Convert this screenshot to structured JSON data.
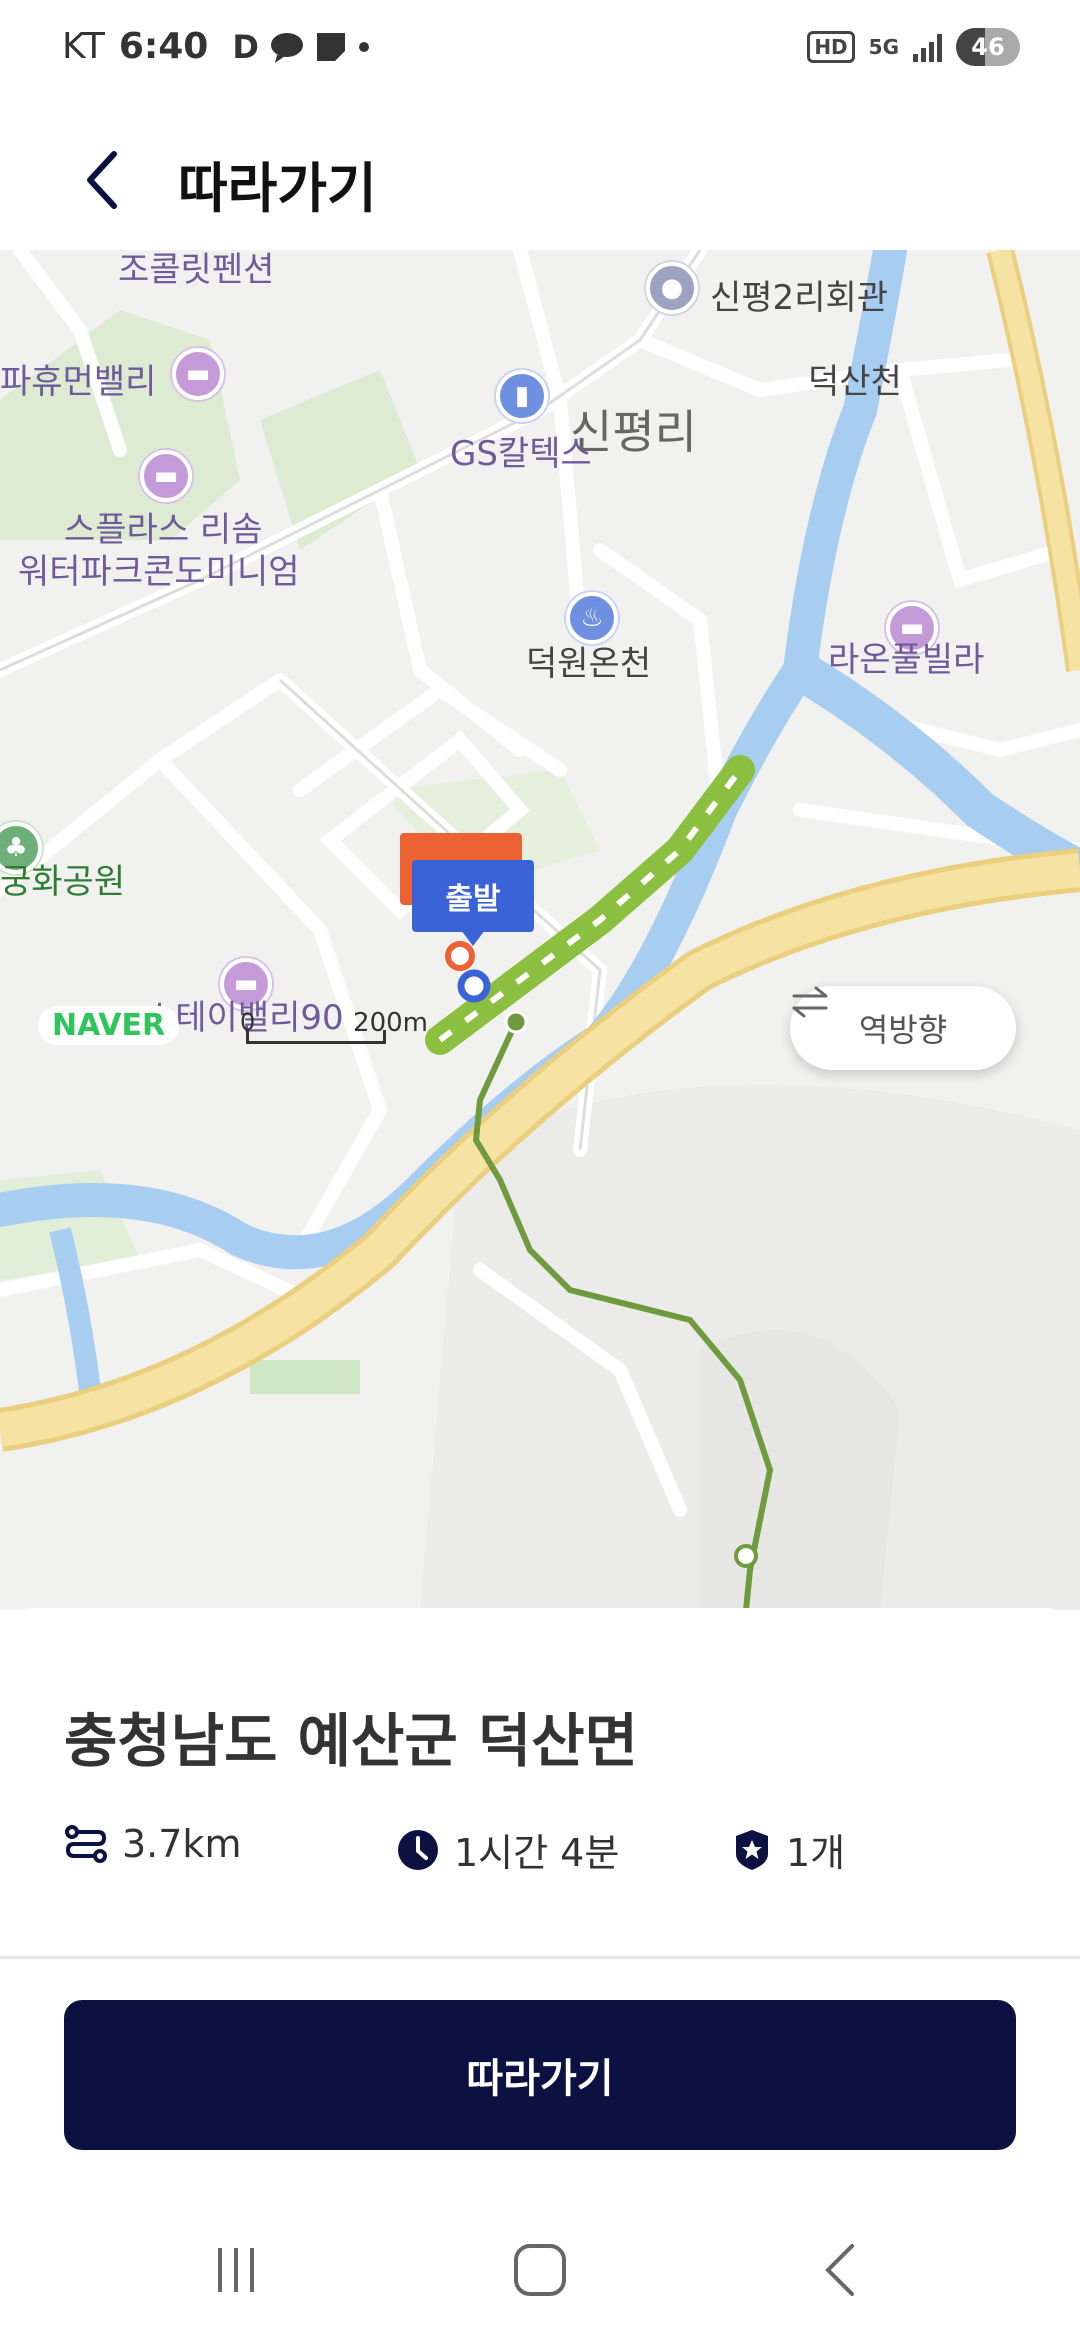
{
  "status_bar": {
    "carrier": "KT",
    "time": "6:40",
    "glyph_d": "D",
    "hd_badge": "HD",
    "network": "5G",
    "battery_percent": "46"
  },
  "header": {
    "title": "따라가기"
  },
  "map": {
    "labels": {
      "chocolate_pension": "조콜릿펜션",
      "sinpyeong_hall": "신평2리회관",
      "human_valley": "파휴먼밸리",
      "gs_caltex": "GS칼텍스",
      "sinpyeong_ri": "신평리",
      "deoksan_stream": "덕산천",
      "resom_line1": "스플라스 리솜",
      "resom_line2": "워터파크콘도미니엄",
      "deokwon_spa": "덕원온천",
      "raon_villa": "라온풀빌라",
      "park": "궁화공원",
      "stay_valley": "스테이밸리90"
    },
    "start_marker": "출발",
    "brand": "NAVER",
    "scale_zero": "0",
    "scale_distance": "200m",
    "reverse_label": "역방향"
  },
  "summary": {
    "location": "충청남도 예산군 덕산면",
    "distance": "3.7km",
    "duration": "1시간 4분",
    "stamps": "1개"
  },
  "actions": {
    "follow_label": "따라가기"
  },
  "colors": {
    "primary_button": "#0b1140",
    "start_marker": "#3a63d8",
    "end_marker": "#ec6233",
    "route": "#8bbf3f",
    "river": "#a7cdf0",
    "highway": "#f6e3a3"
  }
}
